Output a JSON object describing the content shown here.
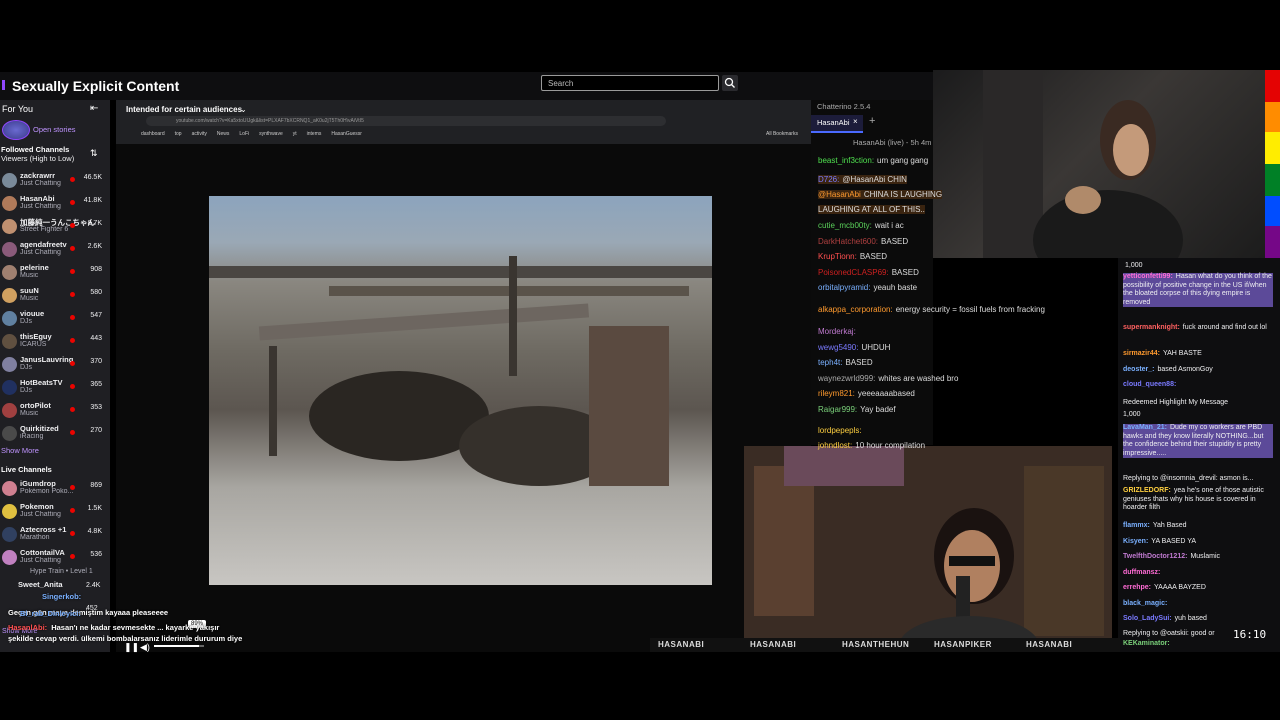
{
  "header": {
    "title": "Sexually Explicit Content",
    "search_placeholder": "Search"
  },
  "sidebar": {
    "for_you": "For You",
    "open_stories": "Open stories",
    "followed_title": "Followed Channels",
    "followed_sort": "Viewers (High to Low)",
    "followed": [
      {
        "name": "zackrawrr",
        "game": "Just Chatting",
        "viewers": "46.5K",
        "color": "#7a8a9a"
      },
      {
        "name": "HasanAbi",
        "game": "Just Chatting",
        "viewers": "41.8K",
        "color": "#b07a5a"
      },
      {
        "name": "加藤純一うんこちゃん",
        "game": "Street Fighter 6",
        "viewers": "8.7K",
        "color": "#c09070"
      },
      {
        "name": "agendafreetv",
        "game": "Just Chatting",
        "viewers": "2.6K",
        "color": "#8a5a7a"
      },
      {
        "name": "pelerine",
        "game": "Music",
        "viewers": "908",
        "color": "#a08070"
      },
      {
        "name": "suuN",
        "game": "Music",
        "viewers": "580",
        "color": "#d0a060"
      },
      {
        "name": "viouue",
        "game": "DJs",
        "viewers": "547",
        "color": "#6080a0"
      },
      {
        "name": "thisEguy",
        "game": "ICARUS",
        "viewers": "443",
        "color": "#605040"
      },
      {
        "name": "JanusLauvring",
        "game": "DJs",
        "viewers": "370",
        "color": "#8080a0"
      },
      {
        "name": "HotBeatsTV",
        "game": "DJs",
        "viewers": "365",
        "color": "#203060"
      },
      {
        "name": "ortoPilot",
        "game": "Music",
        "viewers": "353",
        "color": "#a04040"
      },
      {
        "name": "Quirkitized",
        "game": "iRacing",
        "viewers": "270",
        "color": "#4a4a4a"
      }
    ],
    "show_more": "Show More",
    "live_title": "Live Channels",
    "live": [
      {
        "name": "iGumdrop",
        "game": "Pokémon Poko...",
        "viewers": "869",
        "color": "#d08090"
      },
      {
        "name": "Pokemon",
        "game": "Just Chatting",
        "viewers": "1.5K",
        "color": "#e0c040"
      },
      {
        "name": "Aztecross +1",
        "game": "Marathon",
        "viewers": "4.8K",
        "color": "#304060"
      },
      {
        "name": "CottontailVA",
        "game": "Just Chatting",
        "viewers": "536",
        "color": "#c080c0"
      }
    ],
    "live_extra_tag": "Hype Train • Level 1",
    "peek_label": "Sweet_Anita",
    "peek_viewers": "2.4K",
    "peek_more": "Show More",
    "peek_count": "452"
  },
  "browser": {
    "audience_label": "Intended for certain audiences",
    "url": "youtube.com/watch?v=Ka5xtoUIJgk&list=PLXAF7bXCRNQ1_aK0u2jT5Th0H\\vAiVtI5",
    "bookmarks": [
      "dashboard",
      "top",
      "activity",
      "News",
      "LoFi",
      "synthwave",
      "yt",
      "intems",
      "HasanGuessr"
    ],
    "all_bookmarks": "All Bookmarks"
  },
  "video_overlay_chat": [
    {
      "user": "Singerkob:",
      "text": ""
    },
    {
      "user": "",
      "text": "Geçen gün maya demiştim kayaaa pleaseeee"
    },
    {
      "user": "Bl_rab_Dinleyici:",
      "text": ""
    },
    {
      "user": "HasanlAbi:",
      "text": "Hasan'ı ne kadar sevmesekte ... kayarke yakışır"
    },
    {
      "user": "",
      "text": "şekilde cevap verdi. ülkemi bombalarsanız liderimle dururum diye"
    }
  ],
  "player": {
    "volume_pct": "89%"
  },
  "chatterino": {
    "title": "Chatterino 2.5.4",
    "tab": "HasanAbi",
    "channel_status": "HasanAbi (live) - 5h 4m",
    "messages": [
      {
        "user": "beast_inf3ction:",
        "text": "um gang gang",
        "color": "#4fe04f"
      },
      {
        "user": "D726:",
        "text": "@HasanAbi CHIN",
        "color": "#7a7aff"
      },
      {
        "user": "@HasanAbi",
        "text": "CHINA IS LAUGHING",
        "color": "#ff9a2e"
      },
      {
        "user": "",
        "text": "LAUGHING AT ALL OF THIS..",
        "color": "#ff9a2e"
      },
      {
        "user": "cutie_mcb00ty:",
        "text": "wait i ac",
        "color": "#5ad05a"
      },
      {
        "user": "DarkHatchet600:",
        "text": "BASED",
        "color": "#b04040"
      },
      {
        "user": "KrupTionn:",
        "text": "BASED",
        "color": "#ff5050"
      },
      {
        "user": "PoisonedCLASP69:",
        "text": "BASED",
        "color": "#cc2020"
      },
      {
        "user": "orbitalpyramid:",
        "text": "yeauh baste",
        "color": "#7ab0ff"
      },
      {
        "user": "alkappa_corporation:",
        "text": "energy security = fossil fuels   from fracking",
        "color": "#ff9a2e"
      },
      {
        "user": "Morderkaj:",
        "text": "",
        "color": "#c07ad0"
      },
      {
        "user": "wewg5490:",
        "text": "UHDUH",
        "color": "#7a7aff"
      },
      {
        "user": "teph4t:",
        "text": "BASED",
        "color": "#7ab0ff"
      },
      {
        "user": "waynezwrld999:",
        "text": "whites are washed bro",
        "color": "#aaaaaa"
      },
      {
        "user": "rileym821:",
        "text": "yeeeaaaabased",
        "color": "#ff9a2e"
      },
      {
        "user": "Raigar999:",
        "text": "Yay badef",
        "color": "#7ad07a"
      },
      {
        "user": "lordpepepls:",
        "text": "",
        "color": "#ffd040"
      },
      {
        "user": "johndlost:",
        "text": "10 hour compilation",
        "color": "#ffd040"
      }
    ]
  },
  "right_chat": {
    "top_count": "1,000",
    "messages": [
      {
        "user": "yetticonfetti99:",
        "text": "Hasan what do you think of the possibility of positive change in the US if/when the bloated corpse of this dying empire is removed",
        "color": "#ff6bd5",
        "highlight": true
      },
      {
        "user": "supermanknight:",
        "text": "fuck around and find out lol",
        "color": "#ff6060",
        "highlight": false
      },
      {
        "user": "sirmazir44:",
        "text": "YAH BASTE",
        "color": "#ff9a2e",
        "highlight": false
      },
      {
        "user": "deoster_:",
        "text": "based AsmonGoy",
        "color": "#7ab0ff",
        "highlight": false
      },
      {
        "user": "cloud_queen88:",
        "text": "",
        "color": "#7a7aff",
        "highlight": false
      },
      {
        "user": "",
        "text": "Redeemed Highlight My Message",
        "color": "#efeff1",
        "highlight": false
      },
      {
        "user": "",
        "text": "1,000",
        "color": "#efeff1",
        "highlight": false
      },
      {
        "user": "LavaMan_21:",
        "text": "Dude my co workers are PBD hawks and they know literally NOTHING...but the confidence behind their stupidity is pretty impressive.....",
        "color": "#7ab0ff",
        "highlight": true
      },
      {
        "user": "",
        "text": "Replying to @insomnia_drevil: asmon is...",
        "color": "#adadb8",
        "highlight": false
      },
      {
        "user": "GRIZLEDORF:",
        "text": "yea he's one of those autistic geniuses thats why his house is covered in hoarder filth",
        "color": "#ffd040",
        "highlight": false
      },
      {
        "user": "flammx:",
        "text": "Yah Based",
        "color": "#7ab0ff",
        "highlight": false
      },
      {
        "user": "Kisyen:",
        "text": "YA BASED YA",
        "color": "#7ab0ff",
        "highlight": false
      },
      {
        "user": "TwelfthDoctor1212:",
        "text": "Muslamic",
        "color": "#c07ad0",
        "highlight": false
      },
      {
        "user": "duffmansz:",
        "text": "",
        "color": "#ff6bd5",
        "highlight": false
      },
      {
        "user": "errehpe:",
        "text": "YAAAA BAYZED",
        "color": "#ff6bd5",
        "highlight": false
      },
      {
        "user": "black_magic:",
        "text": "",
        "color": "#7ab0ff",
        "highlight": false
      },
      {
        "user": "Solo_LadySui:",
        "text": "yuh based",
        "color": "#7a7aff",
        "highlight": false
      },
      {
        "user": "",
        "text": "Replying to @oatskii: good or",
        "color": "#adadb8",
        "highlight": false
      },
      {
        "user": "KEKaminator:",
        "text": "",
        "color": "#7ad07a",
        "highlight": false
      }
    ],
    "clock": "16:10"
  },
  "footer": {
    "socials": [
      "HASANABI",
      "HASANABI",
      "HASANTHEHUN",
      "HASANPIKER",
      "HASANABI"
    ]
  },
  "colors": {
    "accent": "#9147ff",
    "live": "#eb0400",
    "highlight": "#5c4a99"
  }
}
